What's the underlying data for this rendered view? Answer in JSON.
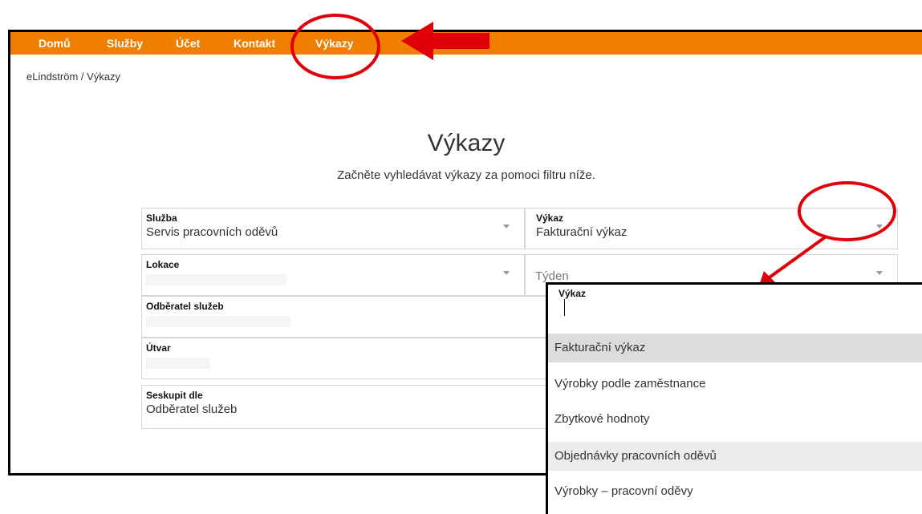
{
  "nav": {
    "items": [
      {
        "label": "Domů"
      },
      {
        "label": "Služby"
      },
      {
        "label": "Účet"
      },
      {
        "label": "Kontakt"
      },
      {
        "label": "Výkazy"
      }
    ],
    "active": "Výkazy"
  },
  "breadcrumb": "eLindström / Výkazy",
  "page": {
    "title": "Výkazy",
    "subtitle": "Začněte vyhledávat výkazy za pomoci filtru níže."
  },
  "filters": {
    "service": {
      "label": "Služba",
      "value": "Servis pracovních oděvů"
    },
    "report": {
      "label": "Výkaz",
      "value": "Fakturační výkaz"
    },
    "location": {
      "label": "Lokace",
      "value": ""
    },
    "week": {
      "placeholder": "Týden"
    },
    "customer": {
      "label": "Odběratel služeb",
      "value": ""
    },
    "department": {
      "label": "Útvar",
      "value": ""
    },
    "group_by": {
      "label": "Seskupit dle",
      "value": "Odběratel služeb"
    }
  },
  "dropdown": {
    "label": "Výkaz",
    "options": [
      "Fakturační výkaz",
      "Výrobky podle zaměstnance",
      "Zbytkové hodnoty",
      "Objednávky pracovních oděvů",
      "Výrobky – pracovní oděvy"
    ]
  },
  "annotation_colors": {
    "highlight": "#e0000a",
    "nav_bg": "#f07f00"
  }
}
